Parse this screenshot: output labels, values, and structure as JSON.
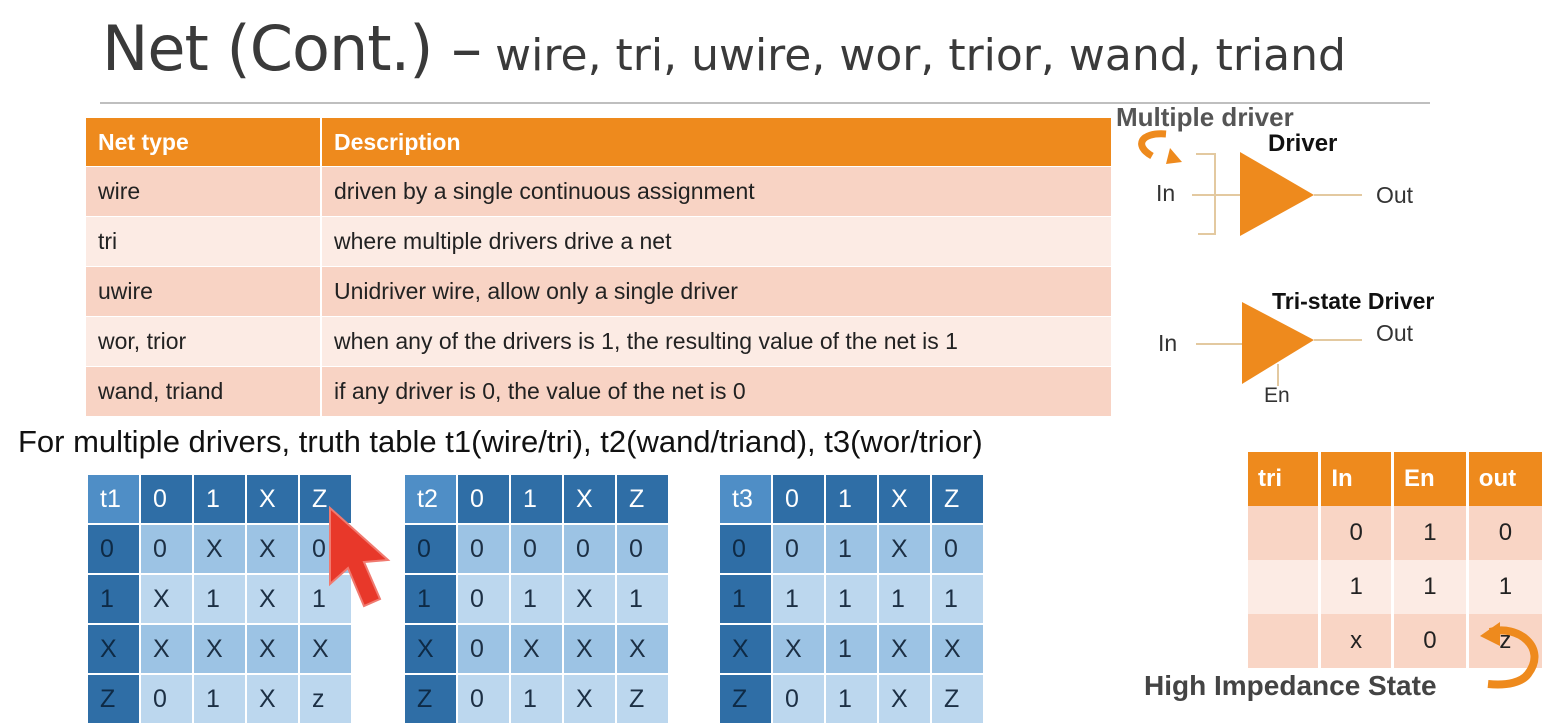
{
  "title": {
    "main": "Net (Cont.) –",
    "sub": "wire, tri, uwire, wor,  trior, wand, triand"
  },
  "net_table": {
    "headers": [
      "Net type",
      "Description"
    ],
    "rows": [
      {
        "type": "wire",
        "description": "driven by a single continuous assignment"
      },
      {
        "type": "tri",
        "description": "where multiple drivers drive a net"
      },
      {
        "type": "uwire",
        "description": "Unidriver wire, allow only a single driver"
      },
      {
        "type": "wor, trior",
        "description": "when any of the drivers is 1, the resulting value of the net is 1"
      },
      {
        "type": "wand, triand",
        "description": "if any driver is 0, the value of the net is 0"
      }
    ]
  },
  "caption": "For multiple drivers, truth table t1(wire/tri), t2(wand/triand), t3(wor/trior)",
  "truth_tables": [
    {
      "name": "t1",
      "cols": [
        "0",
        "1",
        "X",
        "Z"
      ],
      "rows": [
        {
          "h": "0",
          "v": [
            "0",
            "X",
            "X",
            "0"
          ]
        },
        {
          "h": "1",
          "v": [
            "X",
            "1",
            "X",
            "1"
          ]
        },
        {
          "h": "X",
          "v": [
            "X",
            "X",
            "X",
            "X"
          ]
        },
        {
          "h": "Z",
          "v": [
            "0",
            "1",
            "X",
            "z"
          ]
        }
      ]
    },
    {
      "name": "t2",
      "cols": [
        "0",
        "1",
        "X",
        "Z"
      ],
      "rows": [
        {
          "h": "0",
          "v": [
            "0",
            "0",
            "0",
            "0"
          ]
        },
        {
          "h": "1",
          "v": [
            "0",
            "1",
            "X",
            "1"
          ]
        },
        {
          "h": "X",
          "v": [
            "0",
            "X",
            "X",
            "X"
          ]
        },
        {
          "h": "Z",
          "v": [
            "0",
            "1",
            "X",
            "Z"
          ]
        }
      ]
    },
    {
      "name": "t3",
      "cols": [
        "0",
        "1",
        "X",
        "Z"
      ],
      "rows": [
        {
          "h": "0",
          "v": [
            "0",
            "1",
            "X",
            "0"
          ]
        },
        {
          "h": "1",
          "v": [
            "1",
            "1",
            "1",
            "1"
          ]
        },
        {
          "h": "X",
          "v": [
            "X",
            "1",
            "X",
            "X"
          ]
        },
        {
          "h": "Z",
          "v": [
            "0",
            "1",
            "X",
            "Z"
          ]
        }
      ]
    }
  ],
  "driver_diagram": {
    "multiple_driver_label": "Multiple driver",
    "driver_label": "Driver",
    "in_label": "In",
    "out_label": "Out"
  },
  "tristate_diagram": {
    "label": "Tri-state Driver",
    "in_label": "In",
    "out_label": "Out",
    "en_label": "En"
  },
  "tri_table": {
    "headers": [
      "tri",
      "In",
      "En",
      "out"
    ],
    "rows": [
      [
        "",
        "0",
        "1",
        "0"
      ],
      [
        "",
        "1",
        "1",
        "1"
      ],
      [
        "",
        "x",
        "0",
        "z"
      ]
    ]
  },
  "high_impedance_label": "High Impedance State",
  "colors": {
    "orange": "#ee8a1d",
    "blue_header": "#2f6ea6",
    "blue_cell": "#9cc3e4",
    "cursor": "#e8382a"
  }
}
